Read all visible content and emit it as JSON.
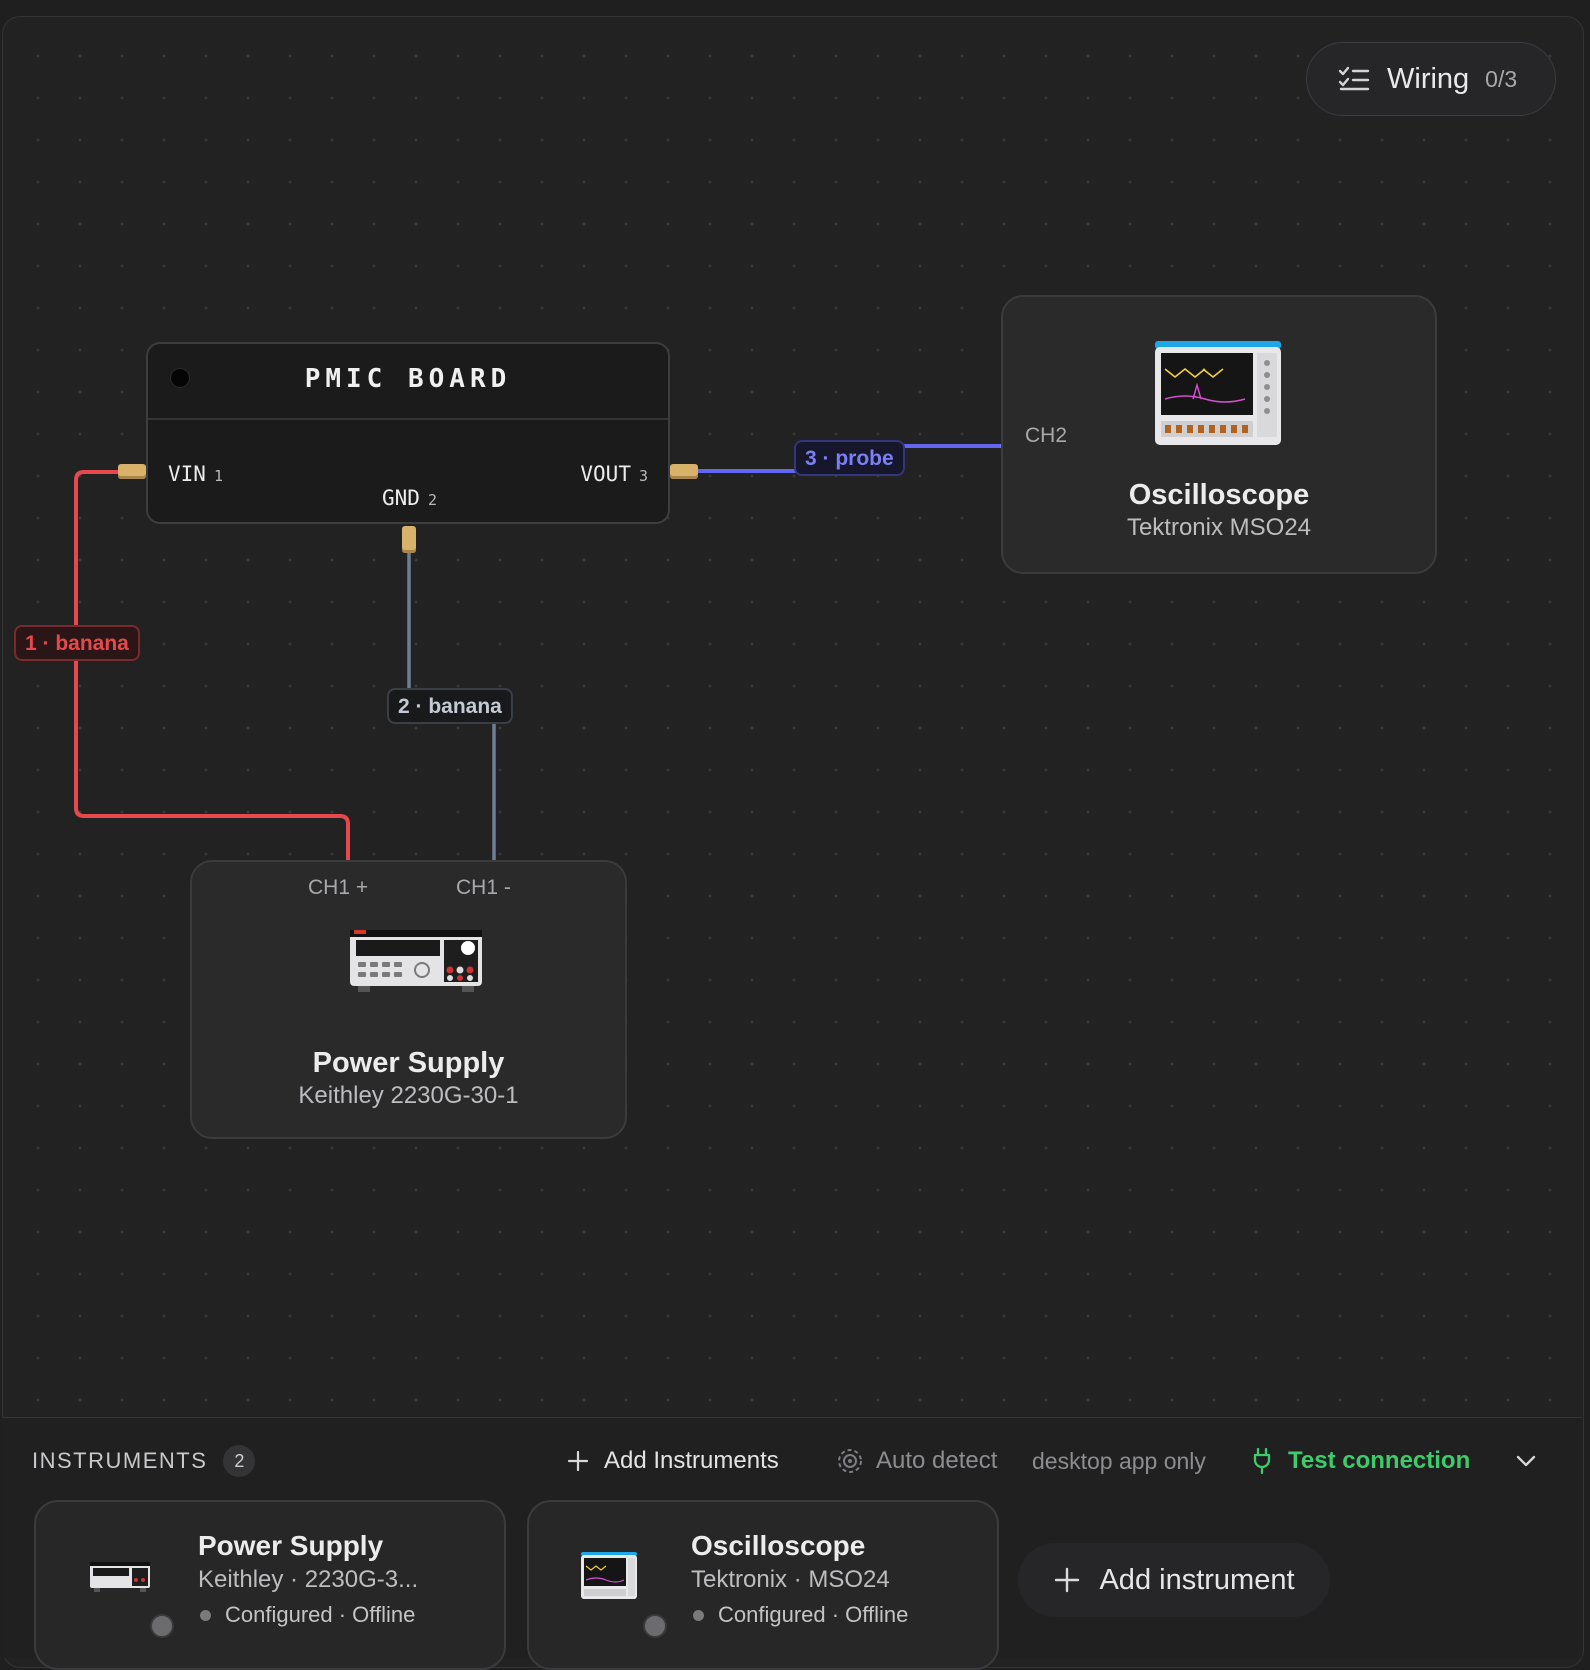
{
  "wiring": {
    "label": "Wiring",
    "count": "0/3"
  },
  "board": {
    "title": "PMIC BOARD",
    "pins": [
      {
        "name": "VIN",
        "num": "1"
      },
      {
        "name": "GND",
        "num": "2"
      },
      {
        "name": "VOUT",
        "num": "3"
      }
    ]
  },
  "connections": [
    {
      "label": "1 · banana",
      "color": "#e5484d"
    },
    {
      "label": "2 · banana",
      "color": "#6b7f96"
    },
    {
      "label": "3 · probe",
      "color": "#6366f1"
    }
  ],
  "oscilloscope_node": {
    "name": "Oscilloscope",
    "model": "Tektronix MSO24",
    "port": "CH2"
  },
  "power_node": {
    "name": "Power Supply",
    "model": "Keithley 2230G-30-1",
    "port_pos": "CH1 +",
    "port_neg": "CH1 -"
  },
  "bottom": {
    "title": "INSTRUMENTS",
    "count": "2",
    "add_instruments": "Add Instruments",
    "auto_detect": "Auto detect",
    "desktop_only": "desktop app only",
    "test_connection": "Test connection",
    "add_instrument": "Add instrument"
  },
  "instruments": [
    {
      "name": "Power Supply",
      "model": "Keithley · 2230G-3...",
      "status": "Configured · Offline"
    },
    {
      "name": "Oscilloscope",
      "model": "Tektronix · MSO24",
      "status": "Configured · Offline"
    }
  ],
  "colors": {
    "accent_green": "#3fcb6a",
    "plug": "#d8b26a"
  },
  "icons": [
    "checklist-icon",
    "plus-icon",
    "radar-icon",
    "plug-icon",
    "chevron-down-icon"
  ]
}
